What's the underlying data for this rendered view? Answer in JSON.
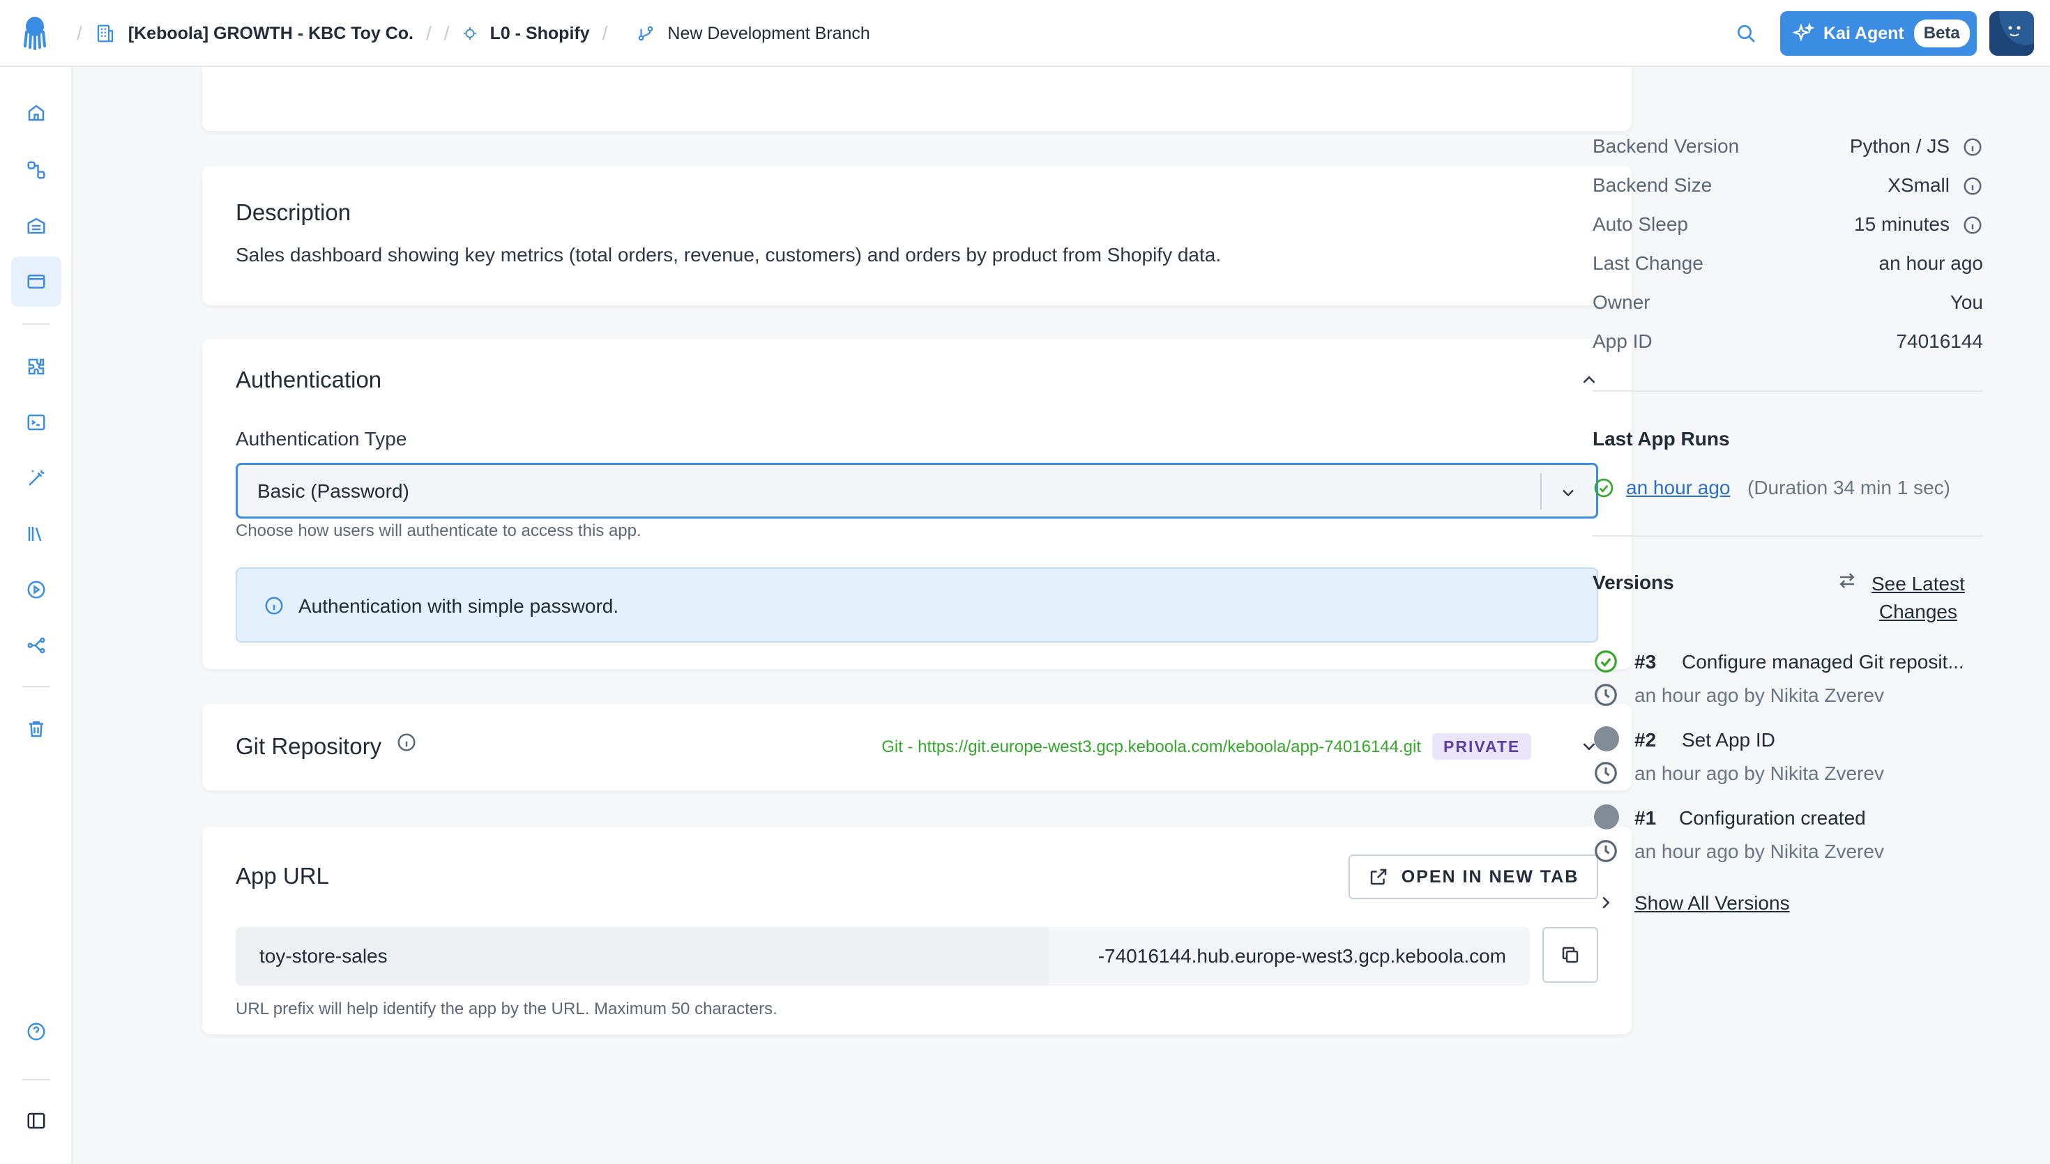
{
  "header": {
    "project": "[Keboola] GROWTH - KBC Toy Co.",
    "configuration": "L0 - Shopify",
    "branch": "New Development Branch",
    "kai_label": "Kai Agent",
    "kai_badge": "Beta",
    "separator": "/"
  },
  "description": {
    "title": "Description",
    "text": "Sales dashboard showing key metrics (total orders, revenue, customers) and orders by product from Shopify data."
  },
  "authentication": {
    "title": "Authentication",
    "type_label": "Authentication Type",
    "type_value": "Basic (Password)",
    "hint": "Choose how users will authenticate to access this app.",
    "info": "Authentication with simple password."
  },
  "git": {
    "title": "Git Repository",
    "link": "Git - https://git.europe-west3.gcp.keboola.com/keboola/app-74016144.git",
    "badge": "PRIVATE"
  },
  "app_url": {
    "title": "App URL",
    "open_button": "OPEN IN NEW TAB",
    "prefix": "toy-store-sales",
    "suffix": "-74016144.hub.europe-west3.gcp.keboola.com",
    "hint": "URL prefix will help identify the app by the URL. Maximum 50 characters."
  },
  "details": [
    {
      "label": "Backend Version",
      "value": "Python / JS",
      "info": true
    },
    {
      "label": "Backend Size",
      "value": "XSmall",
      "info": true
    },
    {
      "label": "Auto Sleep",
      "value": "15 minutes",
      "info": true
    },
    {
      "label": "Last Change",
      "value": "an hour ago",
      "info": false
    },
    {
      "label": "Owner",
      "value": "You",
      "info": false
    },
    {
      "label": "App ID",
      "value": "74016144",
      "info": false
    }
  ],
  "last_runs": {
    "title": "Last App Runs",
    "time": "an hour ago",
    "duration": "(Duration 34 min 1 sec)"
  },
  "versions": {
    "title": "Versions",
    "latest_link_1": "See Latest",
    "latest_link_2": "Changes",
    "items": [
      {
        "num": "#3",
        "name": "Configure managed Git reposit...",
        "meta": "an hour ago by Nikita Zverev",
        "status": "success"
      },
      {
        "num": "#2",
        "name": "Set App ID",
        "meta": "an hour ago by Nikita Zverev",
        "status": "neutral"
      },
      {
        "num": "#1",
        "name": "Configuration created",
        "meta": "an hour ago by Nikita Zverev",
        "status": "neutral"
      }
    ],
    "show_all": "Show All Versions"
  },
  "colors": {
    "accent": "#3a8de3",
    "success": "#34a82b",
    "link": "#2a6fc9",
    "private_badge_bg": "#ebe5fb"
  }
}
